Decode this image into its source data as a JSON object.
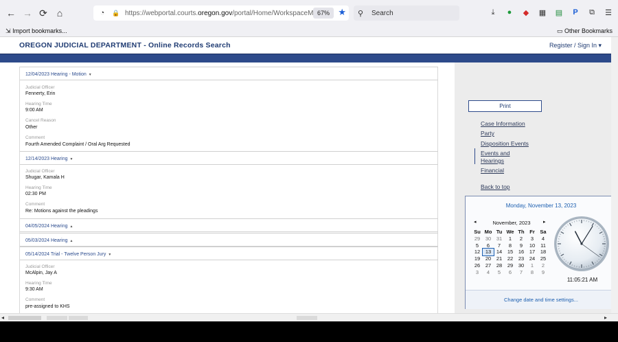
{
  "browser": {
    "url_prefix": "https://webportal.courts.",
    "url_host": "oregon.gov",
    "url_rest": "/portal/Home/WorkspaceMode?p",
    "zoom": "67%",
    "search_placeholder": "Search",
    "bookmarks_import": "Import bookmarks...",
    "bookmarks_other": "Other Bookmarks",
    "icons": {
      "back": "←",
      "forward": "→",
      "reload": "⟳",
      "home": "⌂",
      "shield": "◔",
      "lock": "🔒",
      "star": "★",
      "search": "⚲",
      "download": "⤓",
      "check": "●",
      "abp": "◆",
      "grid": "▦",
      "printer": "▤",
      "p": "P",
      "puzzle": "⧉",
      "menu": "☰",
      "import": "⇲",
      "folder": "▭"
    }
  },
  "site": {
    "title": "OREGON JUDICIAL DEPARTMENT - Online Records Search",
    "register": "Register / Sign In ▾"
  },
  "events": [
    {
      "header": "12/04/2023 Hearing - Motion",
      "caret": "▼",
      "fields": [
        {
          "label": "Judicial Officer",
          "value": "Fennerty, Erin"
        },
        {
          "label": "Hearing Time",
          "value": "9:00 AM"
        },
        {
          "label": "Cancel Reason",
          "value": "Other"
        },
        {
          "label": "Comment",
          "value": "Fourth Amended Complaint / Oral Arg Requested"
        }
      ]
    },
    {
      "header": "12/14/2023 Hearing",
      "caret": "▼",
      "fields": [
        {
          "label": "Judicial Officer",
          "value": "Shugar, Kamala H"
        },
        {
          "label": "Hearing Time",
          "value": "02:30 PM"
        },
        {
          "label": "Comment",
          "value": "Re: Motions against the pleadings"
        }
      ]
    },
    {
      "header": "04/05/2024 Hearing",
      "caret": "▲",
      "fields": []
    },
    {
      "header": "05/03/2024 Hearing",
      "caret": "▲",
      "fields": []
    },
    {
      "header": "05/14/2024 Trial - Twelve Person Jury",
      "caret": "▼",
      "fields": [
        {
          "label": "Judicial Officer",
          "value": "McAlpin, Jay A"
        },
        {
          "label": "Hearing Time",
          "value": "9:30 AM"
        },
        {
          "label": "Comment",
          "value": "pre-assigned to KHS"
        }
      ]
    }
  ],
  "sidebar": {
    "print": "Print",
    "links": [
      "Case Information",
      "Party",
      "Disposition Events",
      "Events and",
      "Hearings",
      "Financial"
    ],
    "back_to_top": "Back to top"
  },
  "calendar": {
    "long_date": "Monday, November 13, 2023",
    "month": "November, 2023",
    "prev": "◂",
    "next": "▸",
    "weekdays": [
      "Su",
      "Mo",
      "Tu",
      "We",
      "Th",
      "Fr",
      "Sa"
    ],
    "weeks": [
      [
        "29",
        "30",
        "31",
        "1",
        "2",
        "3",
        "4"
      ],
      [
        "5",
        "6",
        "7",
        "8",
        "9",
        "10",
        "11"
      ],
      [
        "12",
        "13",
        "14",
        "15",
        "16",
        "17",
        "18"
      ],
      [
        "19",
        "20",
        "21",
        "22",
        "23",
        "24",
        "25"
      ],
      [
        "26",
        "27",
        "28",
        "29",
        "30",
        "1",
        "2"
      ],
      [
        "3",
        "4",
        "5",
        "6",
        "7",
        "8",
        "9"
      ]
    ],
    "today": "13",
    "time": "11:05:21 AM",
    "clock": {
      "hours": 11,
      "minutes": 5,
      "seconds": 21
    },
    "footer_link": "Change date and time settings..."
  },
  "scroll": {
    "left_arrow": "◂",
    "right_arrow": "▸"
  },
  "colors": {
    "brand": "#1f3b72",
    "header_rule": "#2d4a8a",
    "link": "#2b4b8e"
  }
}
